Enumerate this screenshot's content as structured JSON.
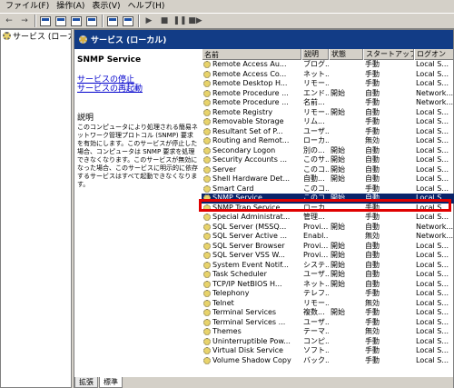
{
  "menu": {
    "items": [
      "ファイル(F)",
      "操作(A)",
      "表示(V)",
      "ヘルプ(H)"
    ]
  },
  "tree": {
    "root": "サービス (ローカル)"
  },
  "header": {
    "title": "サービス (ローカル)"
  },
  "description_pane": {
    "service_name": "SNMP Service",
    "links": [
      "サービスの停止",
      "サービスの再起動"
    ],
    "label": "説明",
    "text": "このコンピュータにより処理される簡易ネットワーク管理プロトコル (SNMP) 要求を有効にします。このサービスが停止した場合、コンピュータは SNMP 要求を処理できなくなります。このサービスが無効になった場合、このサービスに明示的に依存するサービスはすべて起動できなくなります。"
  },
  "columns": [
    "名前",
    "説明",
    "状態",
    "スタートアップの種類",
    "ログオン"
  ],
  "rows": [
    [
      "Remote Access Au...",
      "ブログ...",
      "",
      "手動",
      "Local S..."
    ],
    [
      "Remote Access Co...",
      "ネット...",
      "",
      "手動",
      "Local S..."
    ],
    [
      "Remote Desktop H...",
      "リモー...",
      "",
      "手動",
      "Local S..."
    ],
    [
      "Remote Procedure ...",
      "エンド...",
      "開始",
      "自動",
      "Network..."
    ],
    [
      "Remote Procedure ...",
      "名前...",
      "",
      "手動",
      "Network..."
    ],
    [
      "Remote Registry",
      "リモー...",
      "開始",
      "自動",
      "Local S..."
    ],
    [
      "Removable Storage",
      "リム...",
      "",
      "手動",
      "Local S..."
    ],
    [
      "Resultant Set of P...",
      "ユーザ...",
      "",
      "手動",
      "Local S..."
    ],
    [
      "Routing and Remot...",
      "ローカ...",
      "",
      "無効",
      "Local S..."
    ],
    [
      "Secondary Logon",
      "別の...",
      "開始",
      "自動",
      "Local S..."
    ],
    [
      "Security Accounts ...",
      "このサ...",
      "開始",
      "自動",
      "Local S..."
    ],
    [
      "Server",
      "このコ...",
      "開始",
      "自動",
      "Local S..."
    ],
    [
      "Shell Hardware Det...",
      "自動...",
      "開始",
      "自動",
      "Local S..."
    ],
    [
      "Smart Card",
      "このコ...",
      "",
      "手動",
      "Local S..."
    ],
    [
      "SNMP Service",
      "このコ...",
      "開始",
      "自動",
      "Local S..."
    ],
    [
      "SNMP Trap Service",
      "ローカ...",
      "",
      "手動",
      "Local S..."
    ],
    [
      "Special Administrat...",
      "管理...",
      "",
      "手動",
      "Local S..."
    ],
    [
      "SQL Server (MSSQ...",
      "Provi...",
      "開始",
      "自動",
      "Network..."
    ],
    [
      "SQL Server Active ...",
      "Enabl...",
      "",
      "無効",
      "Network..."
    ],
    [
      "SQL Server Browser",
      "Provi...",
      "開始",
      "自動",
      "Local S..."
    ],
    [
      "SQL Server VSS W...",
      "Provi...",
      "開始",
      "自動",
      "Local S..."
    ],
    [
      "System Event Notif...",
      "システ...",
      "開始",
      "自動",
      "Local S..."
    ],
    [
      "Task Scheduler",
      "ユーザ...",
      "開始",
      "自動",
      "Local S..."
    ],
    [
      "TCP/IP NetBIOS H...",
      "ネット...",
      "開始",
      "自動",
      "Local S..."
    ],
    [
      "Telephony",
      "テレフ...",
      "",
      "手動",
      "Local S..."
    ],
    [
      "Telnet",
      "リモー...",
      "",
      "無効",
      "Local S..."
    ],
    [
      "Terminal Services",
      "複数...",
      "開始",
      "手動",
      "Local S..."
    ],
    [
      "Terminal Services ...",
      "ユーザ...",
      "",
      "手動",
      "Local S..."
    ],
    [
      "Themes",
      "テーマ...",
      "",
      "無効",
      "Local S..."
    ],
    [
      "Uninterruptible Pow...",
      "コンピ...",
      "",
      "手動",
      "Local S..."
    ],
    [
      "Virtual Disk Service",
      "ソフト...",
      "",
      "手動",
      "Local S..."
    ],
    [
      "Volume Shadow Copy",
      "バック...",
      "",
      "手動",
      "Local S..."
    ]
  ],
  "selected_row": 14,
  "tabs": [
    "拡張",
    "標準"
  ],
  "colors": {
    "header_bg": "#123c86",
    "selection": "#0a246a",
    "highlight_box": "#e00000"
  }
}
